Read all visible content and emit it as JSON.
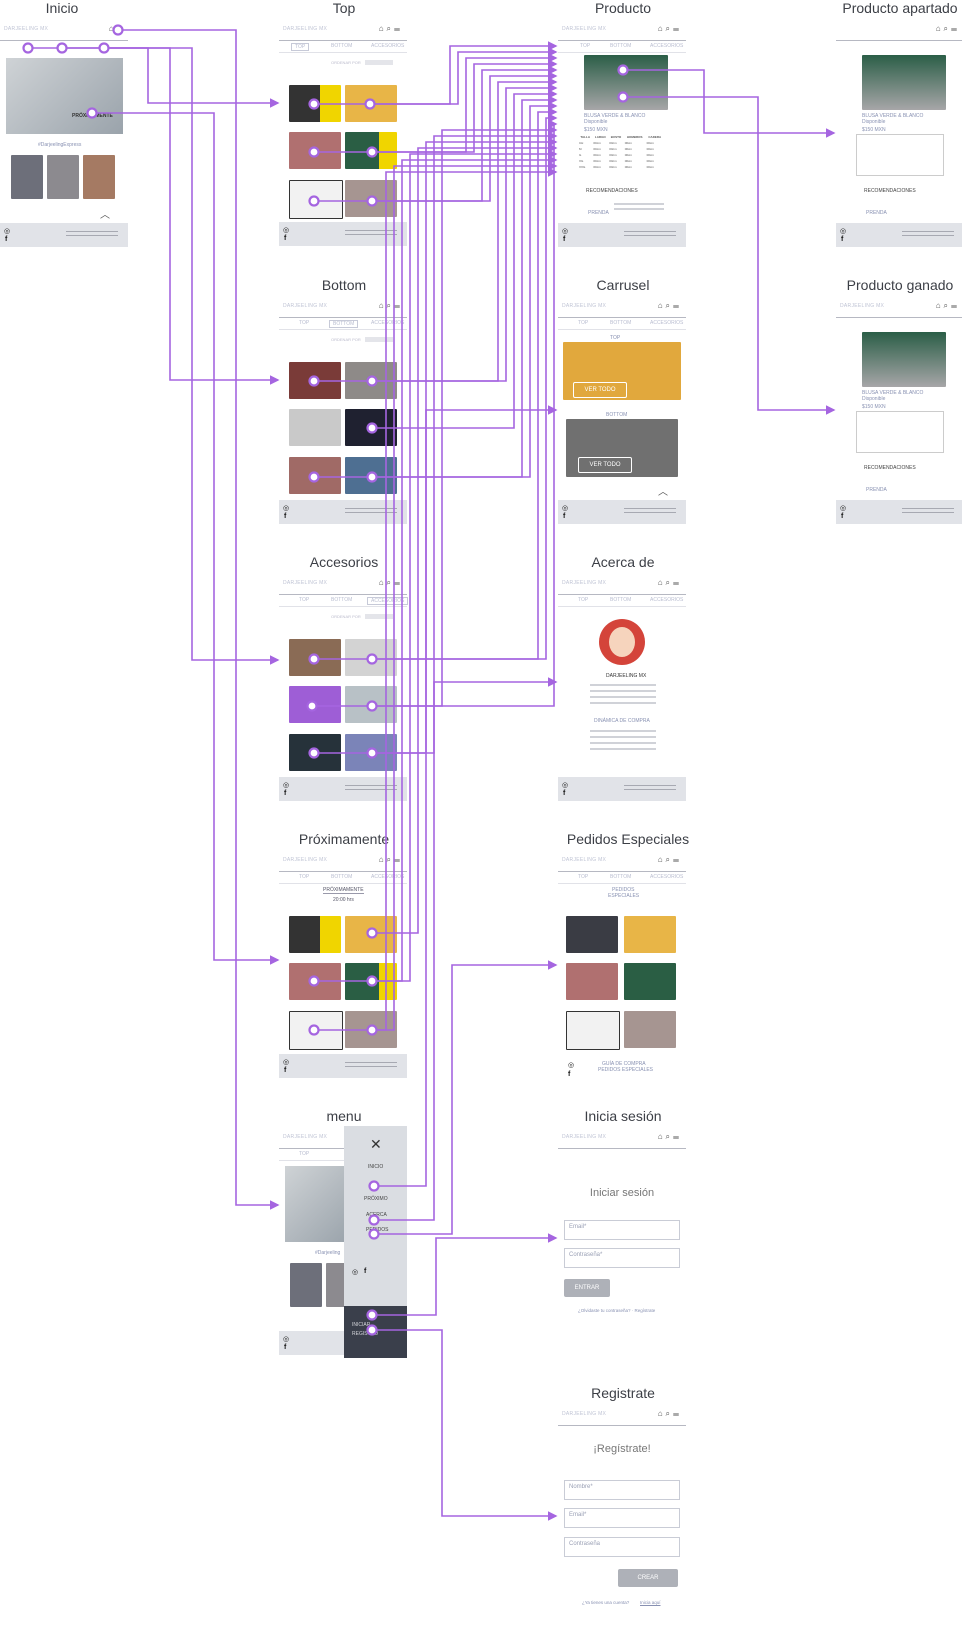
{
  "screens": {
    "inicio": {
      "title": "Inicio",
      "brand": "DARJEELING MX",
      "hashtag": "#DarjeelingExpress",
      "overlay_label": "PRÓXIMAMENTE"
    },
    "top": {
      "title": "Top",
      "brand": "DARJEELING MX",
      "tabs": [
        "TOP",
        "BOTTOM",
        "ACCESORIOS"
      ],
      "ordenar": "ORDENAR POR"
    },
    "producto": {
      "title": "Producto",
      "brand": "DARJEELING MX",
      "tabs": [
        "TOP",
        "BOTTOM",
        "ACCESORIOS"
      ],
      "product_name": "BLUSA VERDE & BLANCO",
      "availability": "Disponible",
      "price": "$150 MXN",
      "size_table": {
        "headers": [
          "TALLA",
          "LARGO",
          "BUSTO",
          "HOMBROS",
          "CADERA"
        ],
        "rows": [
          [
            "CH",
            "00cm",
            "00cm",
            "00cm",
            "00cm"
          ],
          [
            "M",
            "00cm",
            "00cm",
            "00cm",
            "00cm"
          ],
          [
            "G",
            "00cm",
            "00cm",
            "00cm",
            "00cm"
          ],
          [
            "XG",
            "00cm",
            "00cm",
            "00cm",
            "00cm"
          ],
          [
            "XXG",
            "00cm",
            "00cm",
            "00cm",
            "00cm"
          ]
        ]
      },
      "recomendaciones": "RECOMENDACIONES",
      "prenda_label": "PRENDA"
    },
    "producto_apartado": {
      "title": "Producto apartado",
      "product_name": "BLUSA VERDE & BLANCO",
      "availability": "Disponible",
      "price": "$150 MXN",
      "recomendaciones": "RECOMENDACIONES",
      "prenda_label": "PRENDA"
    },
    "producto_ganado": {
      "title": "Producto ganado",
      "brand": "DARJEELING MX",
      "product_name": "BLUSA VERDE & BLANCO",
      "availability": "Disponible",
      "price": "$150 MXN",
      "recomendaciones": "RECOMENDACIONES",
      "prenda_label": "PRENDA"
    },
    "bottom": {
      "title": "Bottom",
      "brand": "DARJEELING MX",
      "tabs": [
        "TOP",
        "BOTTOM",
        "ACCESORIOS"
      ],
      "ordenar": "ORDENAR POR"
    },
    "carrusel": {
      "title": "Carrusel",
      "brand": "DARJEELING MX",
      "tabs": [
        "TOP",
        "BOTTOM",
        "ACCESORIOS"
      ],
      "section_top": "TOP",
      "section_bottom": "BOTTOM",
      "ver_todo": "VER TODO"
    },
    "accesorios": {
      "title": "Accesorios",
      "brand": "DARJEELING MX",
      "tabs": [
        "TOP",
        "BOTTOM",
        "ACCESORIOS"
      ],
      "ordenar": "ORDENAR POR"
    },
    "acerca_de": {
      "title": "Acerca de",
      "brand": "DARJEELING MX",
      "tabs": [
        "TOP",
        "BOTTOM",
        "ACCESORIOS"
      ],
      "name_label": "DARJEELING MX",
      "dinamica_label": "DINÁMICA DE COMPRA"
    },
    "proximamente": {
      "title": "Próximamente",
      "brand": "DARJEELING MX",
      "tabs": [
        "TOP",
        "BOTTOM",
        "ACCESORIOS"
      ],
      "banner": "PRÓXIMAMENTE",
      "countdown": "20:00 hrs"
    },
    "pedidos": {
      "title": "Pedidos Especiales",
      "brand": "DARJEELING MX",
      "tabs": [
        "TOP",
        "BOTTOM",
        "ACCESORIOS"
      ],
      "heading_1": "PEDIDOS",
      "heading_2": "ESPECIALES",
      "guia_1": "GUÍA DE COMPRA",
      "guia_2": "PEDIDOS ESPECIALES"
    },
    "menu": {
      "title": "menu",
      "brand": "DARJEELING MX",
      "tabs": [
        "TOP"
      ],
      "hashtag": "#Darjeeling",
      "items": [
        "INICIO",
        "",
        "PRÓXIMO",
        "ACERCA",
        "PEDIDOS"
      ],
      "login_1": "INICIAR",
      "login_2": "REGISTRO"
    },
    "iniciar": {
      "title": "Inicia sesión",
      "brand": "DARJEELING MX",
      "heading": "Iniciar sesión",
      "email_placeholder": "Email*",
      "password_placeholder": "Contraseña*",
      "submit": "ENTRAR",
      "forgot": "¿Olvidaste tu contraseña? · Regístrate"
    },
    "registrate": {
      "title": "Registrate",
      "brand": "DARJEELING MX",
      "heading": "¡Regístrate!",
      "name_placeholder": "Nombre*",
      "email_placeholder": "Email*",
      "password_placeholder": "Contraseña",
      "submit": "CREAR",
      "have_account": "¿Ya tienes una cuenta?",
      "login_link": "Inicia aquí"
    }
  },
  "colors": {
    "flow": "#a565e0",
    "footer": "#e1e3e8",
    "header_line": "#b6b8c2",
    "menu_dark": "#3a3f4b"
  }
}
